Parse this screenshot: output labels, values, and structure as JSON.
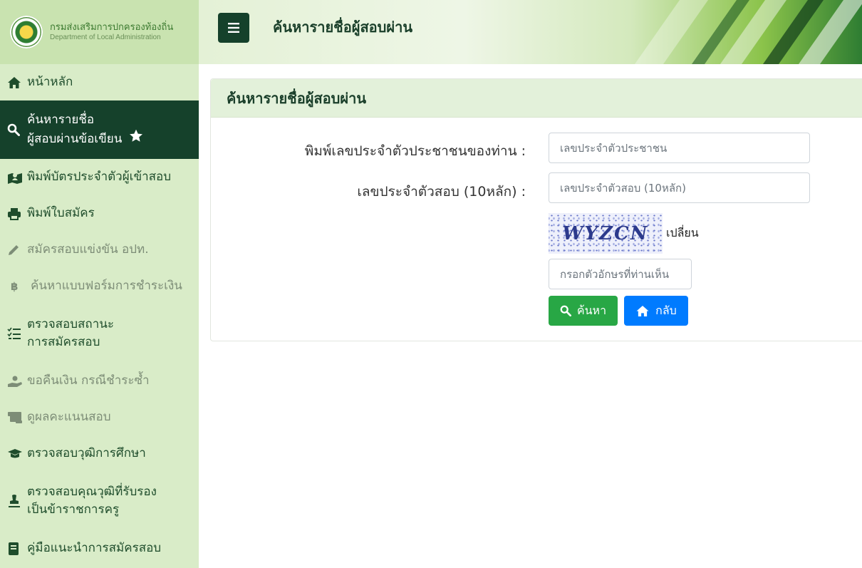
{
  "brand": {
    "name_th": "กรมส่งเสริมการปกครองท้องถิ่น",
    "name_en": "Department of Local Administration"
  },
  "header": {
    "title": "ค้นหารายชื่อผู้สอบผ่าน"
  },
  "sidebar": {
    "items": [
      {
        "label": "หน้าหลัก",
        "icon": "home-icon"
      },
      {
        "label_line1": "ค้นหารายชื่อ",
        "label_line2": "ผู้สอบผ่านข้อเขียน",
        "icon": "search-icon",
        "active": true
      },
      {
        "label": "พิมพ์บัตรประจำตัวผู้เข้าสอบ",
        "icon": "map-user-icon"
      },
      {
        "label": "พิมพ์ใบสมัคร",
        "icon": "print-icon"
      },
      {
        "label": "สมัครสอบแข่งขัน อปท.",
        "icon": "pencil-icon",
        "muted": true
      },
      {
        "label": "ค้นหาแบบฟอร์มการชำระเงิน",
        "icon": "baht-icon",
        "muted": true
      },
      {
        "label_line1": "ตรวจสอบสถานะ",
        "label_line2": "การสมัครสอบ",
        "icon": "checklist-icon"
      },
      {
        "label": "ขอคืนเงิน กรณีชำระซ้ำ",
        "icon": "hand-money-icon",
        "muted": true
      },
      {
        "label": "ดูผลคะแนนสอบ",
        "icon": "scroll-icon",
        "muted": true
      },
      {
        "label": "ตรวจสอบวุฒิการศึกษา",
        "icon": "graduation-cap-icon"
      },
      {
        "label_line1": "ตรวจสอบคุณวุฒิที่รับรอง",
        "label_line2": "เป็นข้าราชการครู",
        "icon": "stamp-icon"
      },
      {
        "label": "คู่มือแนะนำการสมัครสอบ",
        "icon": "book-icon"
      }
    ]
  },
  "card": {
    "title": "ค้นหารายชื่อผู้สอบผ่าน",
    "id_label": "พิมพ์เลขประจำตัวประชาชนของท่าน :",
    "id_placeholder": "เลขประจำตัวประชาชน",
    "exam_label": "เลขประจำตัวสอบ (10หลัก) :",
    "exam_placeholder": "เลขประจำตัวสอบ (10หลัก)",
    "captcha_text": "WYZCN",
    "captcha_change": "เปลี่ยน",
    "captcha_placeholder": "กรอกตัวอักษรที่ท่านเห็น",
    "search_button": "ค้นหา",
    "back_button": "กลับ"
  },
  "colors": {
    "sidebar_bg": "#d9ecc8",
    "active_bg": "#15412b",
    "search_btn": "#28a745",
    "back_btn": "#007bff"
  }
}
